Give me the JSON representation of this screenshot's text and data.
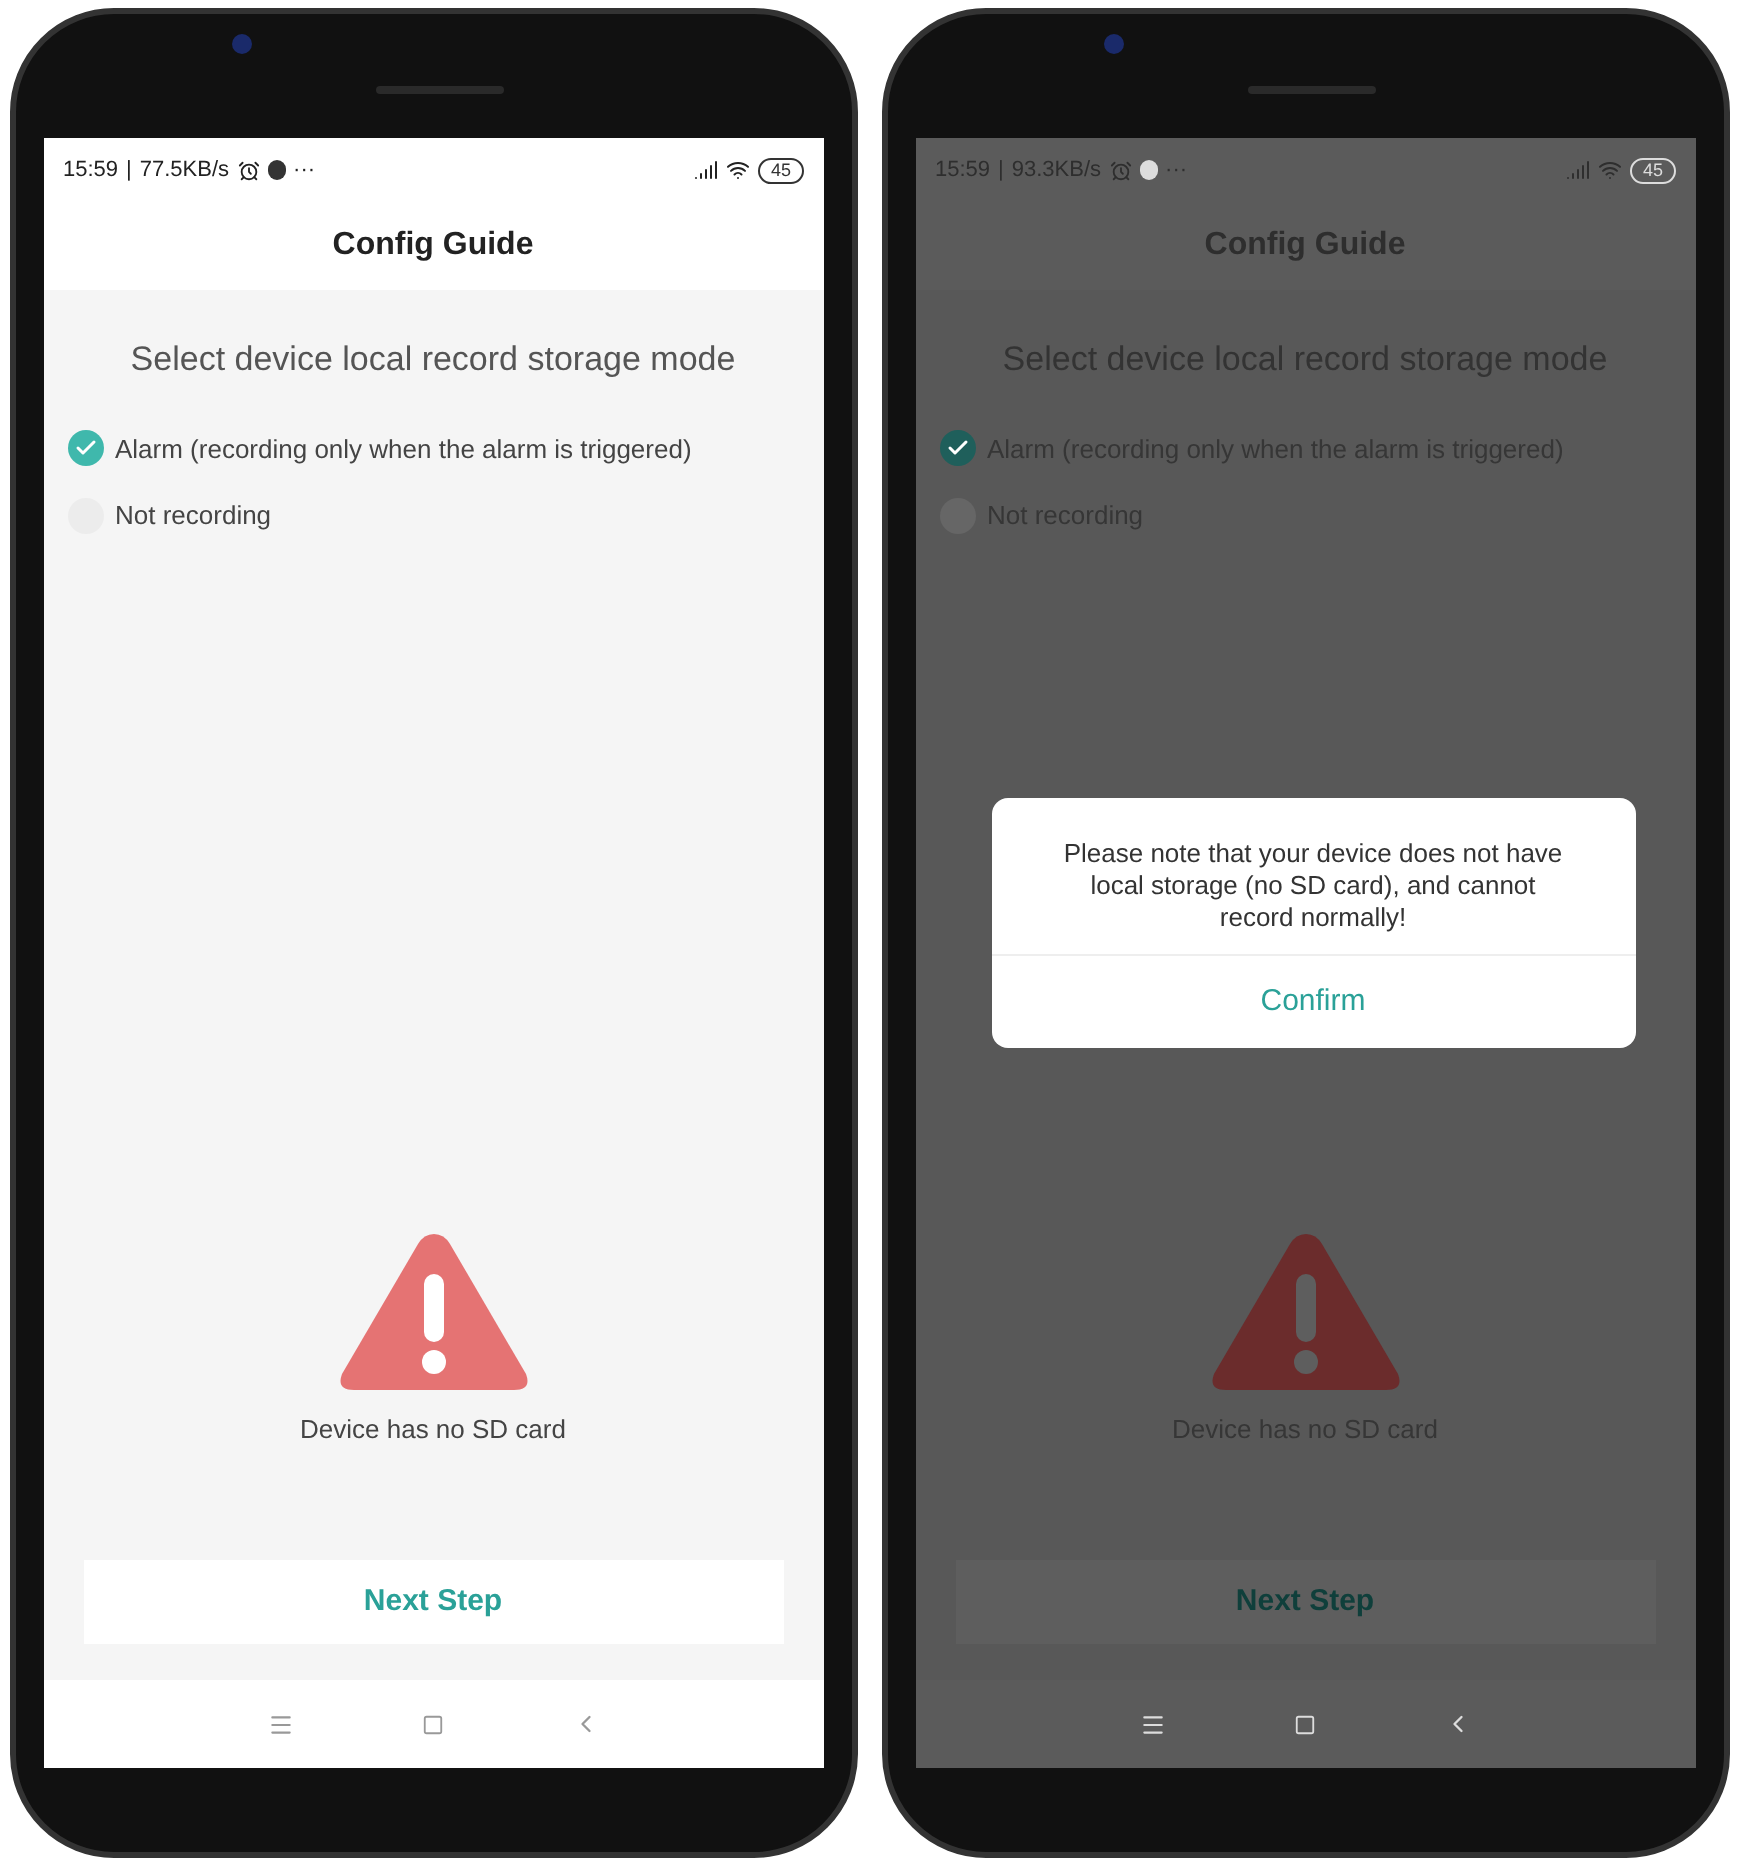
{
  "phones": [
    {
      "dimmed": false,
      "status_bar": {
        "time": "15:59",
        "separator": "|",
        "speed": "77.5KB/s",
        "more": "···",
        "battery": "45"
      },
      "title": "Config Guide",
      "heading": "Select device local record storage mode",
      "options": [
        {
          "label": "Alarm (recording only when the alarm is triggered)",
          "selected": true
        },
        {
          "label": "Not recording",
          "selected": false
        }
      ],
      "warning": "Device has no SD card",
      "next_button": "Next Step"
    },
    {
      "dimmed": true,
      "status_bar": {
        "time": "15:59",
        "separator": "|",
        "speed": "93.3KB/s",
        "more": "···",
        "battery": "45"
      },
      "title": "Config Guide",
      "heading": "Select device local record storage mode",
      "options": [
        {
          "label": "Alarm (recording only when the alarm is triggered)",
          "selected": true
        },
        {
          "label": "Not recording",
          "selected": false
        }
      ],
      "warning": "Device has no SD card",
      "next_button": "Next Step",
      "dialog": {
        "message": "Please note that your device does not have local storage (no SD card), and cannot record normally!",
        "button": "Confirm"
      }
    }
  ]
}
